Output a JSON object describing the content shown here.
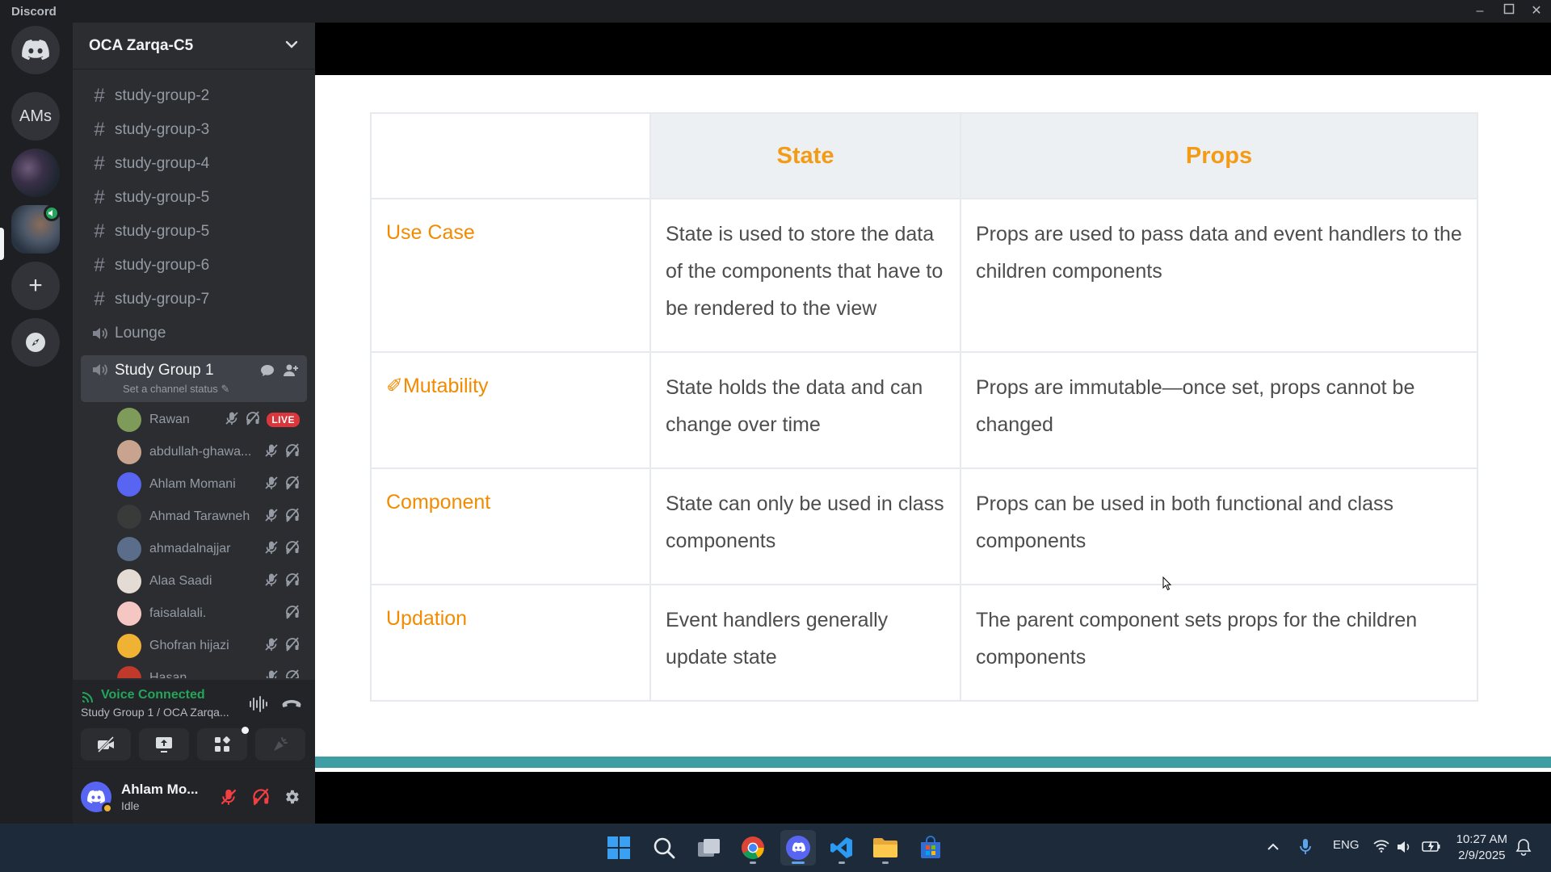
{
  "window": {
    "app_name": "Discord"
  },
  "server_rail": {
    "items": [
      {
        "name": "Direct Messages",
        "icon": "discord-logo-icon"
      },
      {
        "name": "AMs",
        "label": "AMs"
      },
      {
        "name": "Server with photo",
        "icon": "server-avatar"
      },
      {
        "name": "OCA Zarqa-C5",
        "icon": "server-avatar",
        "selected": true
      },
      {
        "name": "Add a Server",
        "icon": "plus-icon"
      },
      {
        "name": "Discover",
        "icon": "compass-icon"
      }
    ]
  },
  "guild": {
    "name": "OCA Zarqa-C5"
  },
  "channels": [
    {
      "type": "text",
      "name": "study-group-2"
    },
    {
      "type": "text",
      "name": "study-group-3"
    },
    {
      "type": "text",
      "name": "study-group-4"
    },
    {
      "type": "text",
      "name": "study-group-5"
    },
    {
      "type": "text",
      "name": "study-group-5"
    },
    {
      "type": "text",
      "name": "study-group-6"
    },
    {
      "type": "text",
      "name": "study-group-7"
    },
    {
      "type": "voice",
      "name": "Lounge"
    }
  ],
  "active_voice_channel": {
    "name": "Study Group 1",
    "status_placeholder": "Set a channel status"
  },
  "voice_members": [
    {
      "name": "Rawan",
      "live": true,
      "live_label": "LIVE",
      "avatar_color": "#7e9b5a"
    },
    {
      "name": "abdullah-ghawa...",
      "avatar_color": "#c8a38f"
    },
    {
      "name": "Ahlam Momani",
      "avatar_color": "#5865f2"
    },
    {
      "name": "Ahmad Tarawneh",
      "avatar_color": "#3a3a3a"
    },
    {
      "name": "ahmadalnajjar",
      "avatar_color": "#5a6d8a"
    },
    {
      "name": "Alaa Saadi",
      "avatar_color": "#e4dcd4"
    },
    {
      "name": "faisalalali.",
      "avatar_color": "#f5c7c2"
    },
    {
      "name": "Ghofran hijazi",
      "avatar_color": "#f0b232"
    },
    {
      "name": "Hasan",
      "avatar_color": "#c0392b"
    }
  ],
  "voice_panel": {
    "title": "Voice Connected",
    "subtitle": "Study Group 1 / OCA Zarqa..."
  },
  "user_panel": {
    "name": "Ahlam Mo...",
    "status": "Idle"
  },
  "slide": {
    "headers": [
      "",
      "State",
      "Props"
    ],
    "rows": [
      {
        "label": "Use Case",
        "state": "State is used to store the data of the components that have to be rendered to the view",
        "props": "Props are used to pass data and event handlers to the children components"
      },
      {
        "label": "✐Mutability",
        "state": "State holds the data and can change over time",
        "props": "Props are immutable—once set, props cannot be changed"
      },
      {
        "label": "Component",
        "state": "State can only be used in class components",
        "props": "Props can be used in both functional and class components"
      },
      {
        "label": "Updation",
        "state": "Event handlers generally update state",
        "props": "The parent component sets props for the children components"
      }
    ]
  },
  "taskbar": {
    "apps": [
      "start",
      "search",
      "task-view",
      "chrome",
      "discord",
      "vscode",
      "file-explorer",
      "microsoft-store"
    ],
    "active_app": "discord",
    "language": "ENG",
    "time": "10:27 AM",
    "date": "2/9/2025"
  }
}
